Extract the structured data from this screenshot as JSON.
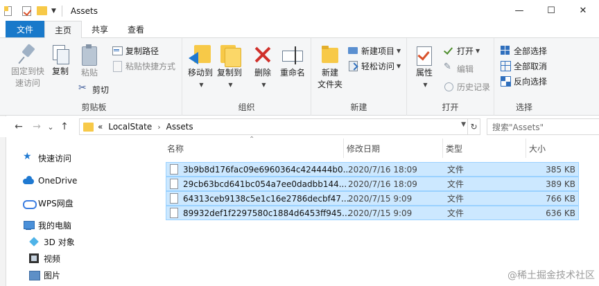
{
  "window": {
    "title": "Assets",
    "controls": {
      "minimize": "—",
      "maximize": "☐",
      "close": "✕"
    }
  },
  "ribbon_tabs": [
    "文件",
    "主页",
    "共享",
    "查看"
  ],
  "ribbon": {
    "clipboard": {
      "label": "剪贴板",
      "pin": "固定到快\n速访问",
      "copy": "复制",
      "paste": "粘贴",
      "copy_path": "复制路径",
      "paste_shortcut": "粘贴快捷方式",
      "cut": "剪切"
    },
    "organize": {
      "label": "组织",
      "move_to": "移动到",
      "copy_to": "复制到",
      "delete": "删除",
      "rename": "重命名"
    },
    "new": {
      "label": "新建",
      "new_folder": "新建\n文件夹",
      "new_item": "新建项目",
      "easy_access": "轻松访问"
    },
    "open": {
      "label": "打开",
      "properties": "属性",
      "open": "打开",
      "edit": "编辑",
      "history": "历史记录"
    },
    "select": {
      "label": "选择",
      "select_all": "全部选择",
      "select_none": "全部取消",
      "invert": "反向选择"
    }
  },
  "address": {
    "back": "←",
    "forward": "→",
    "recent": "⌄",
    "up": "↑",
    "overflow": "«",
    "crumbs": [
      "LocalState",
      "Assets"
    ],
    "search_placeholder": "搜索\"Assets\""
  },
  "nav_pane": [
    {
      "label": "快速访问",
      "icon": "star-icon"
    },
    {
      "label": "OneDrive",
      "icon": "cloud-icon"
    },
    {
      "label": "WPS网盘",
      "icon": "wps-cloud-icon"
    },
    {
      "label": "我的电脑",
      "icon": "computer-icon"
    },
    {
      "label": "3D 对象",
      "icon": "cube-icon"
    },
    {
      "label": "视频",
      "icon": "video-icon"
    },
    {
      "label": "图片",
      "icon": "picture-icon"
    }
  ],
  "columns": [
    "名称",
    "修改日期",
    "类型",
    "大小"
  ],
  "files": [
    {
      "name": "3b9b8d176fac09e6960364c424444b0...",
      "date": "2020/7/16 18:09",
      "type": "文件",
      "size": "385 KB"
    },
    {
      "name": "29cb63bcd641bc054a7ee0dadbb144...",
      "date": "2020/7/16 18:09",
      "type": "文件",
      "size": "389 KB"
    },
    {
      "name": "64313ceb9138c5e1c16e2786decbf47...",
      "date": "2020/7/15 9:09",
      "type": "文件",
      "size": "766 KB"
    },
    {
      "name": "89932def1f2297580c1884d6453ff945...",
      "date": "2020/7/15 9:09",
      "type": "文件",
      "size": "636 KB"
    }
  ],
  "watermark": "@稀土掘金技术社区",
  "colors": {
    "accent": "#1979ca",
    "selection": "#cce8ff",
    "selection_border": "#99d1ff",
    "folder": "#f7c948"
  }
}
